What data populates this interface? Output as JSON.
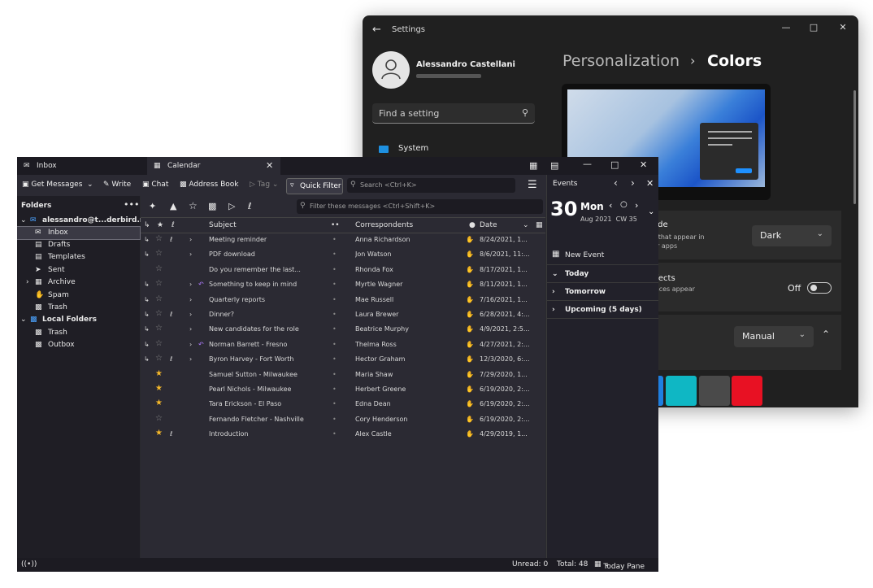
{
  "settings": {
    "title": "Settings",
    "user_name": "Alessandro Castellani",
    "search_placeholder": "Find a setting",
    "nav_system": "System",
    "breadcrumb_parent": "Personalization",
    "breadcrumb_current": "Colors",
    "mode_title": "ode",
    "mode_sub1": "s that appear in",
    "mode_sub2": "ur apps",
    "mode_value": "Dark",
    "effects_title": "ffects",
    "effects_sub": "faces appear",
    "effects_value": "Off",
    "accent_value": "Manual",
    "swatches": [
      "#1f7fe0",
      "#0fb7c4",
      "#4a4a4a",
      "#e81123"
    ]
  },
  "tb": {
    "tabs": [
      "Inbox",
      "Calendar"
    ],
    "toolbar": {
      "get_messages": "Get Messages",
      "write": "Write",
      "chat": "Chat",
      "address_book": "Address Book",
      "tag": "Tag",
      "quick_filter": "Quick Filter",
      "search_placeholder": "Search <Ctrl+K>"
    },
    "folders_header": "Folders",
    "account": "alessandro@t...derbird.net",
    "folders": [
      "Inbox",
      "Drafts",
      "Templates",
      "Sent",
      "Archive",
      "Spam",
      "Trash"
    ],
    "local_folders": "Local Folders",
    "local_items": [
      "Trash",
      "Outbox"
    ],
    "filter_placeholder": "Filter these messages <Ctrl+Shift+K>",
    "columns": {
      "subject": "Subject",
      "correspondents": "Correspondents",
      "date": "Date"
    },
    "messages": [
      {
        "subject": "Meeting reminder",
        "from": "Anna Richardson",
        "date": "8/24/2021, 1..."
      },
      {
        "subject": "PDF download",
        "from": "Jon Watson",
        "date": "8/6/2021, 11:..."
      },
      {
        "subject": "Do you remember the last...",
        "from": "Rhonda Fox",
        "date": "8/17/2021, 1..."
      },
      {
        "subject": "Something to keep in mind",
        "from": "Myrtle Wagner",
        "date": "8/11/2021, 1..."
      },
      {
        "subject": "Quarterly reports",
        "from": "Mae Russell",
        "date": "7/16/2021, 1..."
      },
      {
        "subject": "Dinner?",
        "from": "Laura Brewer",
        "date": "6/28/2021, 4:..."
      },
      {
        "subject": "New candidates for the role",
        "from": "Beatrice Murphy",
        "date": "4/9/2021, 2:5..."
      },
      {
        "subject": "Norman Barrett - Fresno",
        "from": "Thelma Ross",
        "date": "4/27/2021, 2:..."
      },
      {
        "subject": "Byron Harvey - Fort Worth",
        "from": "Hector Graham",
        "date": "12/3/2020, 6:..."
      },
      {
        "subject": "Samuel Sutton - Milwaukee",
        "from": "Maria Shaw",
        "date": "7/29/2020, 1..."
      },
      {
        "subject": "Pearl Nichols - Milwaukee",
        "from": "Herbert Greene",
        "date": "6/19/2020, 2:..."
      },
      {
        "subject": "Tara Erickson - El Paso",
        "from": "Edna Dean",
        "date": "6/19/2020, 2:..."
      },
      {
        "subject": "Fernando Fletcher - Nashville",
        "from": "Cory Henderson",
        "date": "6/19/2020, 2:..."
      },
      {
        "subject": "Introduction",
        "from": "Alex Castle",
        "date": "4/29/2019, 1..."
      }
    ],
    "today_pane": {
      "header": "Events",
      "day": "30",
      "weekday": "Mon",
      "month_year": "Aug 2021",
      "week": "CW 35",
      "new_event": "New Event",
      "sections": [
        "Today",
        "Tomorrow",
        "Upcoming (5 days)"
      ]
    },
    "status": {
      "unread": "Unread: 0",
      "total": "Total: 48",
      "today_pane": "Today Pane"
    }
  }
}
